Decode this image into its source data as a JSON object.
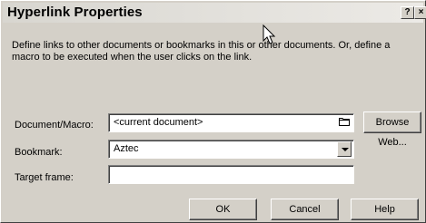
{
  "window": {
    "title": "Hyperlink Properties",
    "help_glyph": "?",
    "close_glyph": "×"
  },
  "description": "Define links to other documents or bookmarks in this or other documents. Or, define a macro to be executed when the user clicks on the link.",
  "fields": {
    "document_macro": {
      "label": "Document/Macro:",
      "value": "<current document>"
    },
    "bookmark": {
      "label": "Bookmark:",
      "value": "Aztec"
    },
    "target_frame": {
      "label": "Target frame:",
      "value": ""
    }
  },
  "buttons": {
    "browse_web": "Browse Web...",
    "ok": "OK",
    "cancel": "Cancel",
    "help": "Help"
  },
  "icons": {
    "folder": "folder-icon",
    "cursor": "mouse-pointer-icon"
  }
}
